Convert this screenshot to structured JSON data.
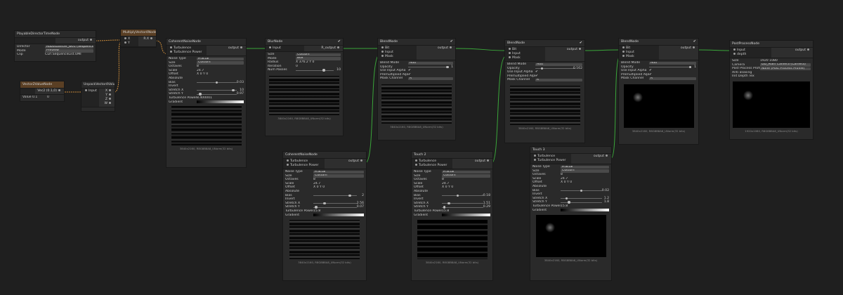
{
  "nodes": {
    "playable": {
      "title": "PlayableDirectorTimeNode",
      "output": "output",
      "rows": [
        {
          "label": "Director",
          "value": "RobotDancer_w01 (Sequence)"
        },
        {
          "label": "Mode",
          "value": "Preview"
        },
        {
          "label": "Clip",
          "value": "Curl.SequenceList.UMI"
        }
      ]
    },
    "multiply": {
      "title": "MultiplyVector4Node",
      "in_x": "X",
      "in_y": "Y",
      "out": "R.X"
    },
    "vector2": {
      "title": "Vector2ValueNode",
      "output": "Vec2 (0.1,0)",
      "label": "Value",
      "x": "0.1",
      "y": "0"
    },
    "unpack": {
      "title": "UnpackVector4ValueNode",
      "input": "Input",
      "outs": [
        "X",
        "Y",
        "Z",
        "W"
      ]
    },
    "curl1": {
      "title": "CoherentNoiseNode",
      "in1": "Turbulence",
      "in2": "Turbulence Power",
      "output": "output",
      "rows": [
        {
          "label": "Noise Type",
          "value": "Fractal"
        },
        {
          "label": "Size",
          "value": "Custom"
        },
        {
          "label": "Octaves",
          "value": "8"
        },
        {
          "label": "Scale",
          "value": "24.7"
        },
        {
          "label": "Offset",
          "value": "X 0   Y 0"
        },
        {
          "label": "Absolute",
          "value": ""
        },
        {
          "label": "Bias",
          "value": "0.03"
        },
        {
          "label": "Invert",
          "value": ""
        },
        {
          "label": "Stretch X",
          "value": "10"
        },
        {
          "label": "Stretch Y",
          "value": "0.97"
        },
        {
          "label": "Turbulence Power",
          "value": "8.400001"
        },
        {
          "label": "Gradient",
          "value": ""
        }
      ],
      "caption": "3840x2160, R8G8B8A8_UNorm(32 bits)"
    },
    "blur": {
      "title": "BlurNode",
      "input": "Input",
      "output": "R_output",
      "rows": [
        {
          "label": "Size",
          "value": "Custom"
        },
        {
          "label": "Mode",
          "value": "Box"
        },
        {
          "label": "Radius",
          "value": "X 376.2   Y 0"
        },
        {
          "label": "Iteration",
          "value": "0"
        },
        {
          "label": "Num Passes",
          "value": "10"
        }
      ],
      "caption": "3840x2160, R8G8B8A8_UNorm(32 bits)"
    },
    "blend1": {
      "title": "BlendNode",
      "ins": [
        "Bit",
        "Input",
        "Mask"
      ],
      "output": "output",
      "rows": [
        {
          "label": "Blend Mode",
          "value": "Add"
        },
        {
          "label": "Opacity",
          "value": "1"
        },
        {
          "label": "Use Input Alpha",
          "value": "✔"
        },
        {
          "label": "Premultiplied Alpha",
          "value": "✔"
        },
        {
          "label": "Mask Channel",
          "value": "R"
        }
      ],
      "caption": "3840x2160, R8G8B8A8_UNorm(32 bits)"
    },
    "blend2": {
      "title": "BlendNode",
      "ins": [
        "Bit",
        "Input",
        "Mask"
      ],
      "output": "output",
      "rows": [
        {
          "label": "Blend Mode",
          "value": "Add"
        },
        {
          "label": "Opacity",
          "value": "0.162"
        },
        {
          "label": "Use Input Alpha",
          "value": "✔"
        },
        {
          "label": "Premultiplied Alpha",
          "value": "✔"
        },
        {
          "label": "Mask Channel",
          "value": "R"
        }
      ],
      "caption": "3840x2160, R8G8B8A8_UNorm(32 bits)"
    },
    "blend3": {
      "title": "BlendNode",
      "ins": [
        "Bit",
        "Input",
        "Mask"
      ],
      "output": "output",
      "rows": [
        {
          "label": "Blend Mode",
          "value": "Add"
        },
        {
          "label": "Opacity",
          "value": "1"
        },
        {
          "label": "Use Input Alpha",
          "value": "✔"
        },
        {
          "label": "Premultiplied Alpha",
          "value": "✔"
        },
        {
          "label": "Mask Channel",
          "value": "R"
        }
      ],
      "caption": "3840x2160, R8G8B8A8_UNorm(32 bits)"
    },
    "post": {
      "title": "PostProcessNode",
      "ins": [
        "Input",
        "depth"
      ],
      "output": "output",
      "rows": [
        {
          "label": "Size",
          "value": "1920   1080"
        },
        {
          "label": "Camera",
          "value": "DD_Main Camera (Camera)"
        },
        {
          "label": "Post Process Profile",
          "value": "None (Post Process Profile)"
        },
        {
          "label": "Anti aliasing",
          "value": ""
        },
        {
          "label": "Init Depth Tex",
          "value": ""
        }
      ],
      "caption": "1920x1080, R8G8B8A8_UNorm(32 bits)"
    },
    "curl2": {
      "title": "CoherentNoiseNode",
      "in1": "Turbulence",
      "in2": "Turbulence Power",
      "output": "output",
      "rows": [
        {
          "label": "Noise Type",
          "value": "Fractal"
        },
        {
          "label": "Size",
          "value": "Custom"
        },
        {
          "label": "Octaves",
          "value": "8"
        },
        {
          "label": "Scale",
          "value": "24.7"
        },
        {
          "label": "Offset",
          "value": "X 0   Y 0"
        },
        {
          "label": "Absolute",
          "value": ""
        },
        {
          "label": "Bias",
          "value": "2"
        },
        {
          "label": "Invert",
          "value": ""
        },
        {
          "label": "Stretch X",
          "value": "2.56"
        },
        {
          "label": "Stretch Y",
          "value": "0.07"
        },
        {
          "label": "Turbulence Power",
          "value": "15.8"
        },
        {
          "label": "Gradient",
          "value": ""
        }
      ],
      "caption": "3840x2160, R8G8B8A8_UNorm(32 bits)"
    },
    "touch2": {
      "title": "Touch 2",
      "in1": "Turbulence",
      "in2": "Turbulence Power",
      "output": "output",
      "rows": [
        {
          "label": "Noise Type",
          "value": "Fractal"
        },
        {
          "label": "Size",
          "value": "Custom"
        },
        {
          "label": "Octaves",
          "value": "8"
        },
        {
          "label": "Scale",
          "value": "24.7"
        },
        {
          "label": "Offset",
          "value": "X 0   Y 0"
        },
        {
          "label": "Absolute",
          "value": ""
        },
        {
          "label": "Bias",
          "value": "-0.18"
        },
        {
          "label": "Invert",
          "value": ""
        },
        {
          "label": "Stretch X",
          "value": "1.51"
        },
        {
          "label": "Stretch Y",
          "value": "0.29"
        },
        {
          "label": "Turbulence Power",
          "value": "15.8"
        },
        {
          "label": "Gradient",
          "value": ""
        }
      ],
      "caption": "3840x2160, R8G8B8A8_UNorm(32 bits)"
    },
    "touch3": {
      "title": "Touch 3",
      "in1": "Turbulence",
      "in2": "Turbulence Power",
      "output": "output",
      "rows": [
        {
          "label": "Noise Type",
          "value": "Fractal"
        },
        {
          "label": "Size",
          "value": "Custom"
        },
        {
          "label": "Octaves",
          "value": "8"
        },
        {
          "label": "Scale",
          "value": "24.7"
        },
        {
          "label": "Offset",
          "value": "X 0   Y 0"
        },
        {
          "label": "Absolute",
          "value": ""
        },
        {
          "label": "Bias",
          "value": "0.02"
        },
        {
          "label": "Invert",
          "value": ""
        },
        {
          "label": "Stretch X",
          "value": "1.2"
        },
        {
          "label": "Stretch Y",
          "value": "1.8"
        },
        {
          "label": "Turbulence Power",
          "value": "15.8"
        },
        {
          "label": "Gradient",
          "value": ""
        }
      ],
      "caption": "3840x2160, R8G8B8A8_UNorm(32 bits)"
    }
  },
  "colors": {
    "canvas": "#1f1f1f",
    "node": "#2a2a2a",
    "wire_green": "#3aa63a",
    "wire_orange": "#c98a3a"
  }
}
